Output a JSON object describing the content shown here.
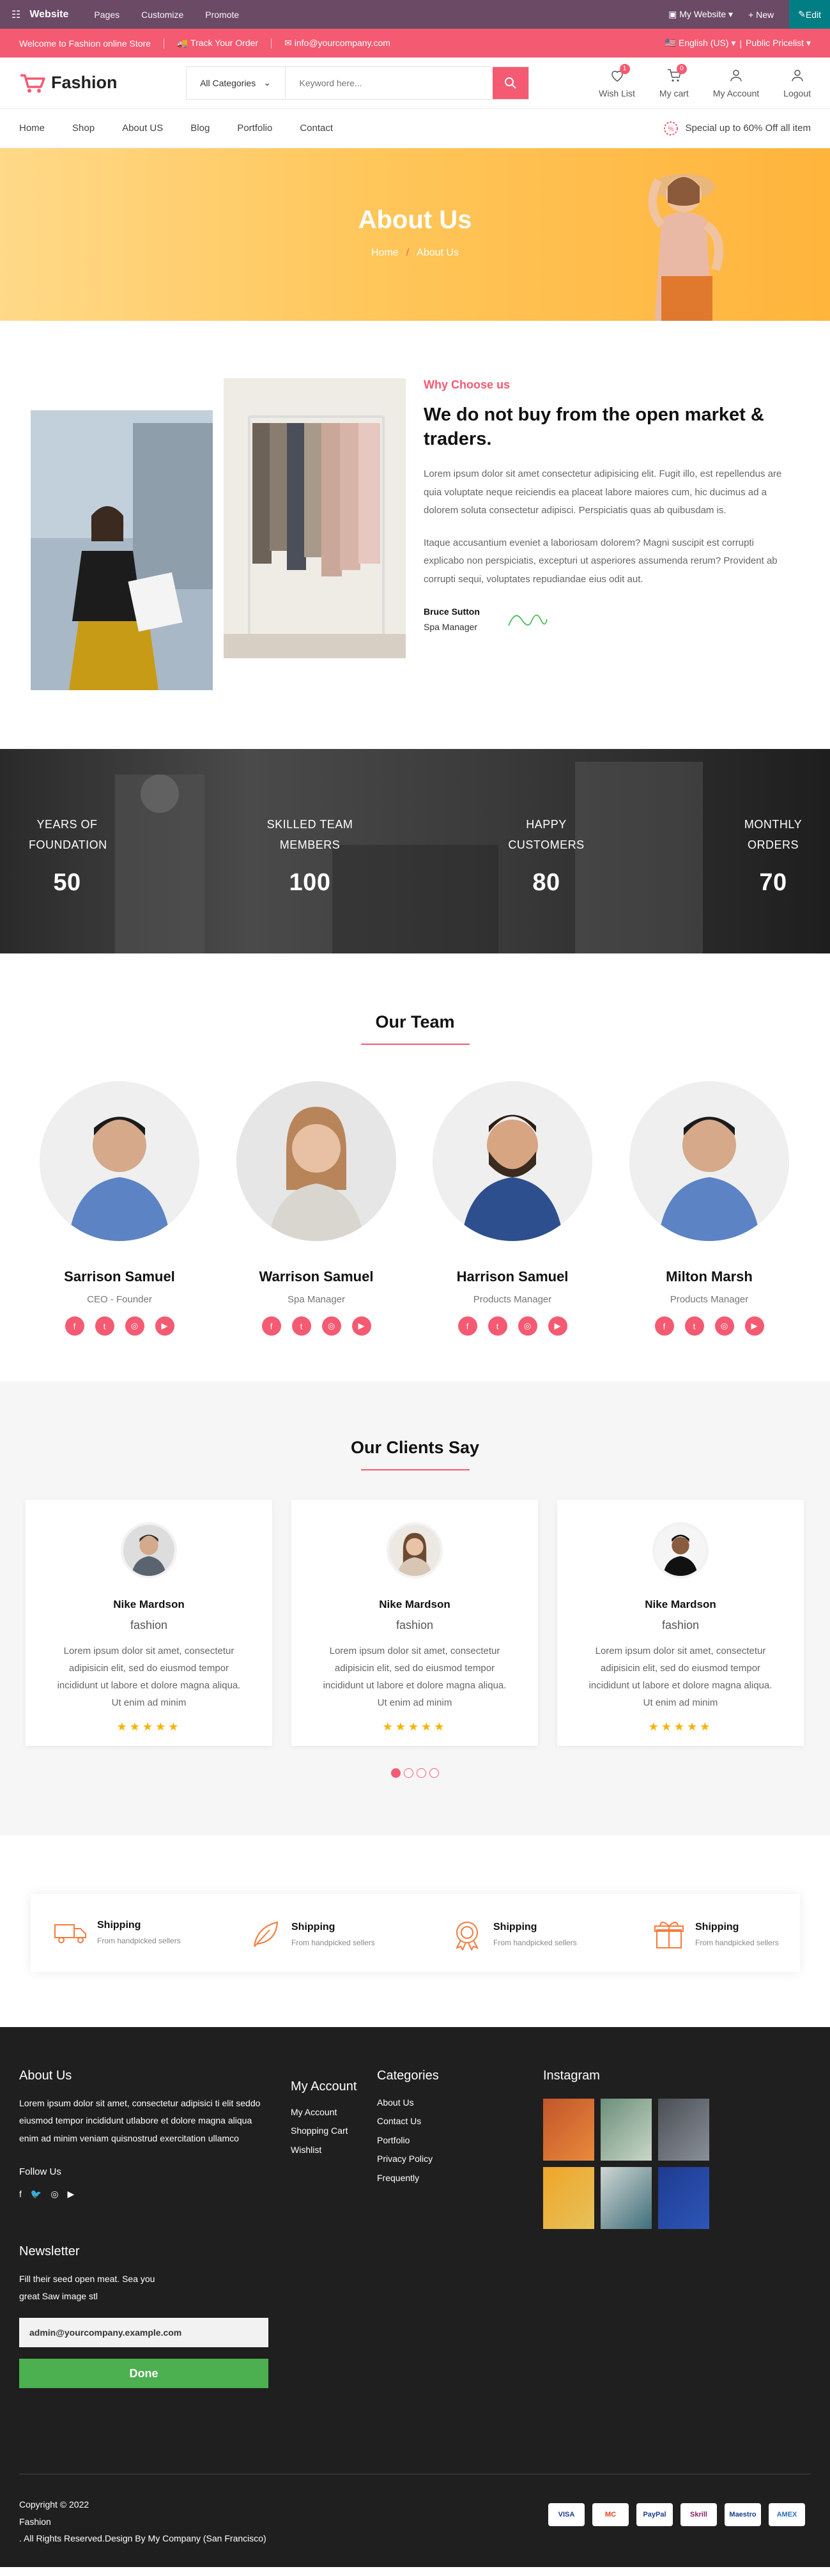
{
  "odoo_bar": {
    "brand": "Website",
    "menu": [
      "Pages",
      "Customize",
      "Promote"
    ],
    "my_website": "My Website",
    "new": "+ New",
    "edit": "Edit"
  },
  "topbar": {
    "welcome": "Welcome to Fashion online Store",
    "track": "Track Your Order",
    "email": "info@yourcompany.com",
    "language": "English (US)",
    "pricelist": "Public Pricelist"
  },
  "header": {
    "logo": "Fashion",
    "category": "All Categories",
    "search_placeholder": "Keyword here...",
    "icons": [
      {
        "label": "Wish List",
        "badge": "1"
      },
      {
        "label": "My cart",
        "badge": "0"
      },
      {
        "label": "My Account"
      },
      {
        "label": "Logout"
      }
    ]
  },
  "nav": {
    "items": [
      "Home",
      "Shop",
      "About US",
      "Blog",
      "Portfolio",
      "Contact"
    ],
    "promo": "Special up to 60% Off all item"
  },
  "banner": {
    "title": "About Us",
    "crumb_home": "Home",
    "crumb_sep": "/",
    "crumb_current": "About Us"
  },
  "why": {
    "kicker": "Why Choose us",
    "heading": "We do not buy from the open market & traders.",
    "para1": "Lorem ipsum dolor sit amet consectetur adipisicing elit. Fugit illo, est repellendus are quia voluptate neque reiciendis ea placeat labore maiores cum, hic ducimus ad a dolorem soluta consectetur adipisci. Perspiciatis quas ab quibusdam is.",
    "para2": "Itaque accusantium eveniet a laboriosam dolorem? Magni suscipit est corrupti explicabo non perspiciatis, excepturi ut asperiores assumenda rerum? Provident ab corrupti sequi, voluptates repudiandae eius odit aut.",
    "signer_name": "Bruce Sutton",
    "signer_role": "Spa Manager"
  },
  "stats": [
    {
      "line1": "YEARS OF",
      "line2": "FOUNDATION",
      "value": "50"
    },
    {
      "line1": "SKILLED TEAM",
      "line2": "MEMBERS",
      "value": "100"
    },
    {
      "line1": "HAPPY",
      "line2": "CUSTOMERS",
      "value": "80"
    },
    {
      "line1": "MONTHLY",
      "line2": "ORDERS",
      "value": "70"
    }
  ],
  "team": {
    "title": "Our Team",
    "members": [
      {
        "name": "Sarrison Samuel",
        "role": "CEO - Founder"
      },
      {
        "name": "Warrison Samuel",
        "role": "Spa Manager"
      },
      {
        "name": "Harrison Samuel",
        "role": "Products Manager"
      },
      {
        "name": "Milton Marsh",
        "role": "Products Manager"
      }
    ]
  },
  "clients": {
    "title": "Our Clients Say",
    "items": [
      {
        "name": "Nike Mardson",
        "sub": "fashion",
        "text": "Lorem ipsum dolor sit amet, consectetur adipisicin elit, sed do eiusmod tempor incididunt ut labore et dolore magna aliqua. Ut enim ad minim",
        "stars": "★★★★★"
      },
      {
        "name": "Nike Mardson",
        "sub": "fashion",
        "text": "Lorem ipsum dolor sit amet, consectetur adipisicin elit, sed do eiusmod tempor incididunt ut labore et dolore magna aliqua. Ut enim ad minim",
        "stars": "★★★★★"
      },
      {
        "name": "Nike Mardson",
        "sub": "fashion",
        "text": "Lorem ipsum dolor sit amet, consectetur adipisicin elit, sed do eiusmod tempor incididunt ut labore et dolore magna aliqua. Ut enim ad minim",
        "stars": "★★★★★"
      }
    ]
  },
  "features": [
    {
      "title": "Shipping",
      "sub": "From handpicked sellers",
      "icon": "truck-icon"
    },
    {
      "title": "Shipping",
      "sub": "From handpicked sellers",
      "icon": "leaf-icon"
    },
    {
      "title": "Shipping",
      "sub": "From handpicked sellers",
      "icon": "badge-icon"
    },
    {
      "title": "Shipping",
      "sub": "From handpicked sellers",
      "icon": "gift-icon"
    }
  ],
  "footer": {
    "about_title": "About Us",
    "about_text": "Lorem ipsum dolor sit amet, consectetur adipisici ti elit seddo eiusmod tempor incididunt utlabore et dolore magna aliqua enim ad minim veniam quisnostrud exercitation ullamco",
    "follow": "Follow Us",
    "account_title": "My Account",
    "account_links": [
      "My Account",
      "Shopping Cart",
      "Wishlist"
    ],
    "categories_title": "Categories",
    "category_links": [
      "About Us",
      "Contact Us",
      "Portfolio",
      "Privacy Policy",
      "Frequently"
    ],
    "instagram_title": "Instagram",
    "newsletter_title": "Newsletter",
    "newsletter_text": "Fill their seed open meat. Sea you great Saw image stl",
    "newsletter_email": "admin@yourcompany.example.com",
    "done": "Done",
    "copyright1": "Copyright © 2022",
    "copyright2": "Fashion",
    "copyright3": ". All Rights Reserved.Design By My Company (San Francisco)",
    "payments": [
      "VISA",
      "MC",
      "PayPal",
      "Skrill",
      "Maestro",
      "AMEX"
    ]
  },
  "colors": {
    "accent": "#f45a72",
    "odoo": "#6b4a66",
    "footer": "#1f1f1f"
  }
}
